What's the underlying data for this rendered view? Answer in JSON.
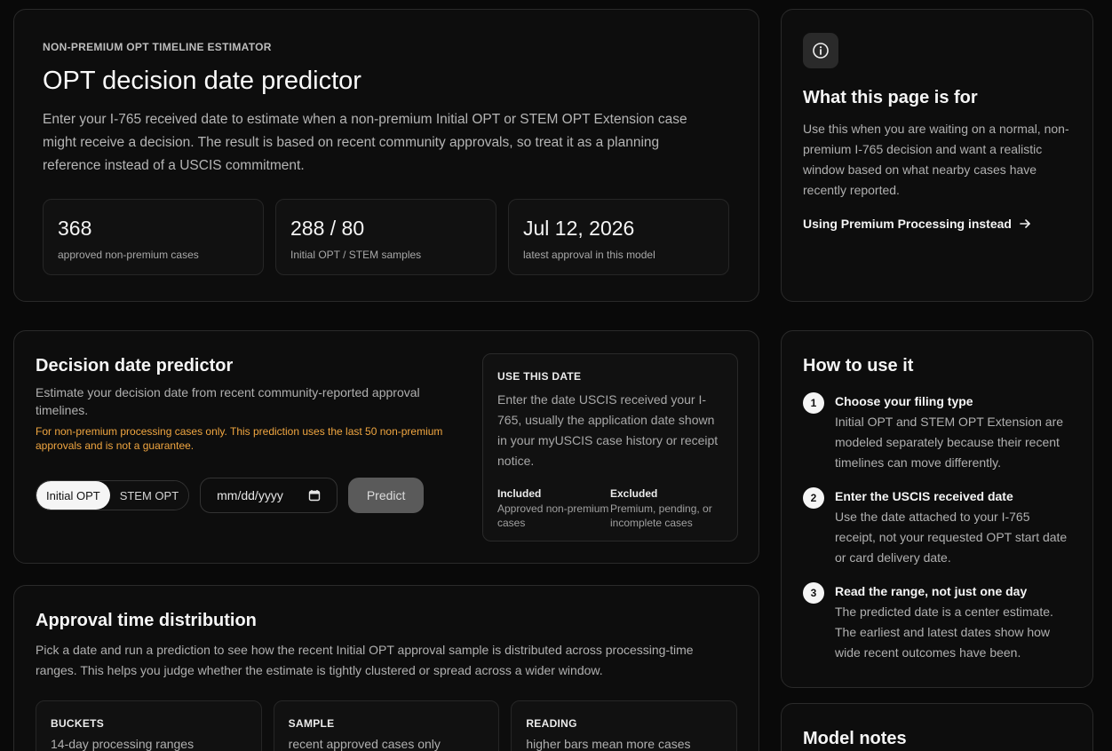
{
  "hero": {
    "eyebrow": "NON-PREMIUM OPT TIMELINE ESTIMATOR",
    "title": "OPT decision date predictor",
    "description": "Enter your I-765 received date to estimate when a non-premium Initial OPT or STEM OPT Extension case might receive a decision. The result is based on recent community approvals, so treat it as a planning reference instead of a USCIS commitment.",
    "stats": [
      {
        "value": "368",
        "label": "approved non-premium cases"
      },
      {
        "value": "288 / 80",
        "label": "Initial OPT / STEM samples"
      },
      {
        "value": "Jul 12, 2026",
        "label": "latest approval in this model"
      }
    ]
  },
  "about": {
    "icon": "info-icon",
    "title": "What this page is for",
    "text": "Use this when you are waiting on a normal, non-premium I-765 decision and want a realistic window based on what nearby cases have recently reported.",
    "link": "Using Premium Processing instead",
    "link_icon": "arrow-right-icon"
  },
  "predictor": {
    "title": "Decision date predictor",
    "description": "Estimate your decision date from recent community-reported approval timelines.",
    "warning": "For non-premium processing cases only. This prediction uses the last 50 non-premium approvals and is not a guarantee.",
    "toggle": {
      "options": [
        "Initial OPT",
        "STEM OPT"
      ],
      "selected": "Initial OPT"
    },
    "date_placeholder": "mm/dd/yyyy",
    "button": "Predict",
    "use_date": {
      "title": "USE THIS DATE",
      "text": "Enter the date USCIS received your I-765, usually the application date shown in your myUSCIS case history or receipt notice.",
      "included_title": "Included",
      "included_text": "Approved non-premium cases",
      "excluded_title": "Excluded",
      "excluded_text": "Premium, pending, or incomplete cases"
    }
  },
  "distribution": {
    "title": "Approval time distribution",
    "description": "Pick a date and run a prediction to see how the recent Initial OPT approval sample is distributed across processing-time ranges. This helps you judge whether the estimate is tightly clustered or spread across a wider window.",
    "boxes": [
      {
        "title": "BUCKETS",
        "text": "14-day processing ranges"
      },
      {
        "title": "SAMPLE",
        "text": "recent approved cases only"
      },
      {
        "title": "READING",
        "text": "higher bars mean more cases"
      }
    ]
  },
  "howto": {
    "title": "How to use it",
    "steps": [
      {
        "num": "1",
        "title": "Choose your filing type",
        "text": "Initial OPT and STEM OPT Extension are modeled separately because their recent timelines can move differently."
      },
      {
        "num": "2",
        "title": "Enter the USCIS received date",
        "text": "Use the date attached to your I-765 receipt, not your requested OPT start date or card delivery date."
      },
      {
        "num": "3",
        "title": "Read the range, not just one day",
        "text": "The predicted date is a center estimate. The earliest and latest dates show how wide recent outcomes have been."
      }
    ]
  },
  "notes": {
    "title": "Model notes"
  }
}
